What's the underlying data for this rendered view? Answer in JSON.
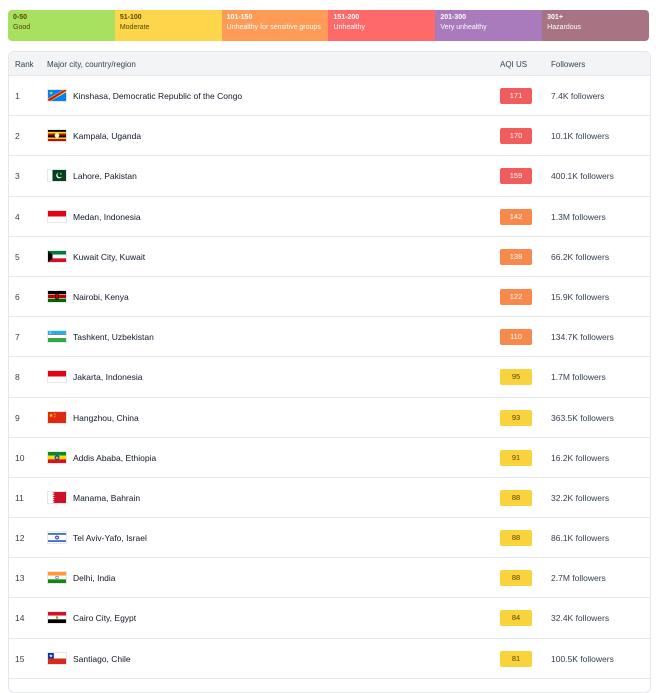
{
  "scale": [
    {
      "range": "0-50",
      "label": "Good",
      "color": "#a8e05f",
      "text_dark": true
    },
    {
      "range": "51-100",
      "label": "Moderate",
      "color": "#fdd64b",
      "text_dark": true
    },
    {
      "range": "101-150",
      "label": "Unhealthy for sensitive groups",
      "color": "#ff9b57",
      "text_dark": false
    },
    {
      "range": "151-200",
      "label": "Unhealthy",
      "color": "#fe6a69",
      "text_dark": false
    },
    {
      "range": "201-300",
      "label": "Very unhealthy",
      "color": "#a97abc",
      "text_dark": false
    },
    {
      "range": "301+",
      "label": "Hazardous",
      "color": "#a87383",
      "text_dark": false
    }
  ],
  "table": {
    "headers": {
      "rank": "Rank",
      "city": "Major city, country/region",
      "aqi": "AQI US",
      "followers": "Followers"
    },
    "rows": [
      {
        "rank": "1",
        "city": "Kinshasa, Democratic Republic of the Congo",
        "aqi": "171",
        "followers": "7.4K followers",
        "flag": "congo-dr"
      },
      {
        "rank": "2",
        "city": "Kampala, Uganda",
        "aqi": "170",
        "followers": "10.1K followers",
        "flag": "uganda"
      },
      {
        "rank": "3",
        "city": "Lahore, Pakistan",
        "aqi": "159",
        "followers": "400.1K followers",
        "flag": "pakistan"
      },
      {
        "rank": "4",
        "city": "Medan, Indonesia",
        "aqi": "142",
        "followers": "1.3M followers",
        "flag": "indonesia"
      },
      {
        "rank": "5",
        "city": "Kuwait City, Kuwait",
        "aqi": "138",
        "followers": "66.2K followers",
        "flag": "kuwait"
      },
      {
        "rank": "6",
        "city": "Nairobi, Kenya",
        "aqi": "122",
        "followers": "15.9K followers",
        "flag": "kenya"
      },
      {
        "rank": "7",
        "city": "Tashkent, Uzbekistan",
        "aqi": "110",
        "followers": "134.7K followers",
        "flag": "uzbekistan"
      },
      {
        "rank": "8",
        "city": "Jakarta, Indonesia",
        "aqi": "95",
        "followers": "1.7M followers",
        "flag": "indonesia"
      },
      {
        "rank": "9",
        "city": "Hangzhou, China",
        "aqi": "93",
        "followers": "363.5K followers",
        "flag": "china"
      },
      {
        "rank": "10",
        "city": "Addis Ababa, Ethiopia",
        "aqi": "91",
        "followers": "16.2K followers",
        "flag": "ethiopia"
      },
      {
        "rank": "11",
        "city": "Manama, Bahrain",
        "aqi": "88",
        "followers": "32.2K followers",
        "flag": "bahrain"
      },
      {
        "rank": "12",
        "city": "Tel Aviv-Yafo, Israel",
        "aqi": "88",
        "followers": "86.1K followers",
        "flag": "israel"
      },
      {
        "rank": "13",
        "city": "Delhi, India",
        "aqi": "88",
        "followers": "2.7M followers",
        "flag": "india"
      },
      {
        "rank": "14",
        "city": "Cairo City, Egypt",
        "aqi": "84",
        "followers": "32.4K followers",
        "flag": "egypt"
      },
      {
        "rank": "15",
        "city": "Santiago, Chile",
        "aqi": "81",
        "followers": "100.5K followers",
        "flag": "chile"
      }
    ]
  },
  "aqi_colors": {
    "unhealthy": "#f15c5c",
    "sensitive": "#f6894b",
    "moderate": "#f9d33d"
  }
}
